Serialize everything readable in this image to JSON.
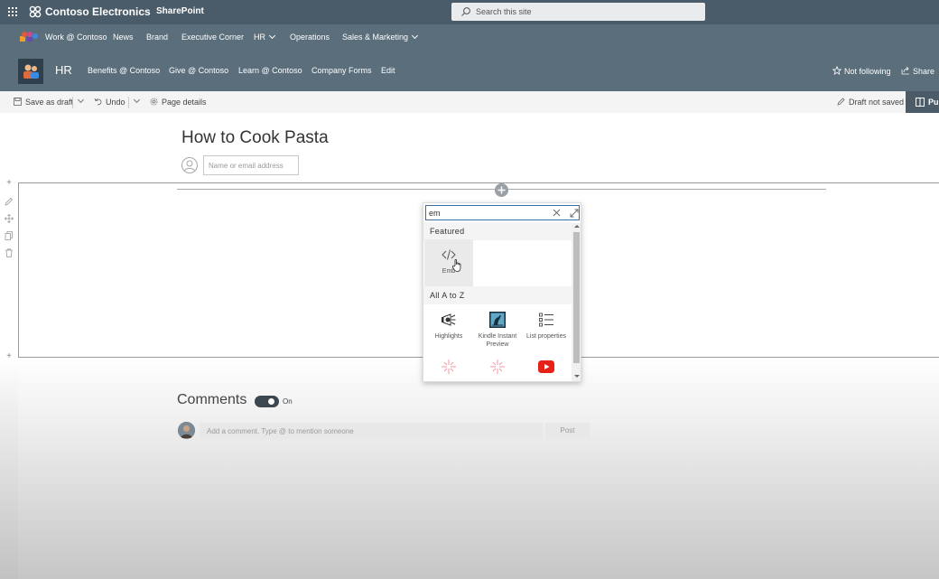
{
  "suite_bar": {
    "brand": "Contoso Electronics",
    "app": "SharePoint",
    "search_placeholder": "Search this site"
  },
  "hub_nav": {
    "items": [
      "Work @ Contoso",
      "News",
      "Brand",
      "Executive Corner",
      "HR",
      "Operations",
      "Sales & Marketing"
    ]
  },
  "site_header": {
    "title": "HR",
    "links": [
      "Benefits @ Contoso",
      "Give @ Contoso",
      "Learn @ Contoso",
      "Company Forms",
      "Edit"
    ],
    "follow_label": "Not following",
    "share_label": "Share"
  },
  "command_bar": {
    "save_label": "Save as draft",
    "undo_label": "Undo",
    "details_label": "Page details",
    "status_label": "Draft not saved",
    "publish_label": "Pu"
  },
  "page": {
    "title": "How to Cook Pasta",
    "author_placeholder": "Name or email address"
  },
  "toolbox": {
    "search_value": "em",
    "featured_heading": "Featured",
    "featured_tiles": [
      {
        "label": "Emb",
        "icon": "embed-code-icon"
      }
    ],
    "az_heading": "All A to Z",
    "az_tiles": [
      {
        "label": "Highlights",
        "icon": "highlights-icon"
      },
      {
        "label": "Kindle Instant Preview",
        "icon": "kindle-icon"
      },
      {
        "label": "List properties",
        "icon": "list-properties-icon"
      },
      {
        "label": "",
        "icon": "sparkle-icon"
      },
      {
        "label": "",
        "icon": "sparkle-icon"
      },
      {
        "label": "",
        "icon": "youtube-icon"
      }
    ]
  },
  "comments": {
    "title": "Comments",
    "toggle_label": "On",
    "toggle_on": true,
    "input_placeholder": "Add a comment. Type @ to mention someone",
    "post_label": "Post"
  },
  "colors": {
    "suite_bar": "#4a5c69",
    "nav": "#5a6e7b",
    "publish": "#4b5b68",
    "youtube_red": "#e62117",
    "search_focus": "#3a6ea5"
  }
}
